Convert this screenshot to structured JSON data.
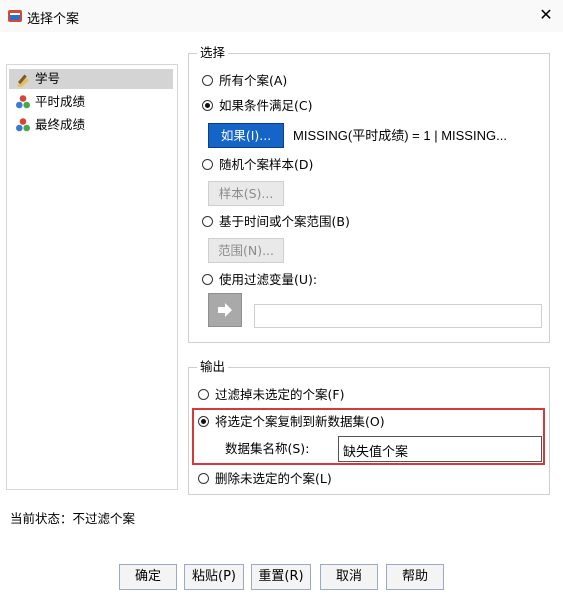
{
  "window": {
    "title": "选择个案",
    "close_label": "✕"
  },
  "variables": [
    {
      "label": "学号",
      "icon": "ruler-pencil-icon",
      "selected": true
    },
    {
      "label": "平时成绩",
      "icon": "nominal-scale-icon",
      "selected": false
    },
    {
      "label": "最终成绩",
      "icon": "nominal-scale-icon",
      "selected": false
    }
  ],
  "select_group": {
    "title": "选择",
    "all_cases": "所有个案(A)",
    "if_condition": "如果条件满足(C)",
    "if_button": "如果(I)...",
    "condition_text": "MISSING(平时成绩) = 1 | MISSING...",
    "random_sample": "随机个案样本(D)",
    "sample_button": "样本(S)...",
    "time_range": "基于时间或个案范围(B)",
    "range_button": "范围(N)...",
    "filter_var": "使用过滤变量(U):",
    "filter_value": ""
  },
  "output_group": {
    "title": "输出",
    "filter_out": "过滤掉未选定的个案(F)",
    "copy_to_new": "将选定个案复制到新数据集(O)",
    "dataset_name_label": "数据集名称(S):",
    "dataset_name_value": "缺失值个案",
    "delete_unselected": "删除未选定的个案(L)"
  },
  "status": {
    "text": "当前状态：不过滤个案"
  },
  "buttons": {
    "ok": "确定",
    "paste": "粘贴(P)",
    "reset": "重置(R)",
    "cancel": "取消",
    "help": "帮助"
  },
  "colors": {
    "primary_button": "#1565c8",
    "highlight_border": "#d53a3a"
  }
}
